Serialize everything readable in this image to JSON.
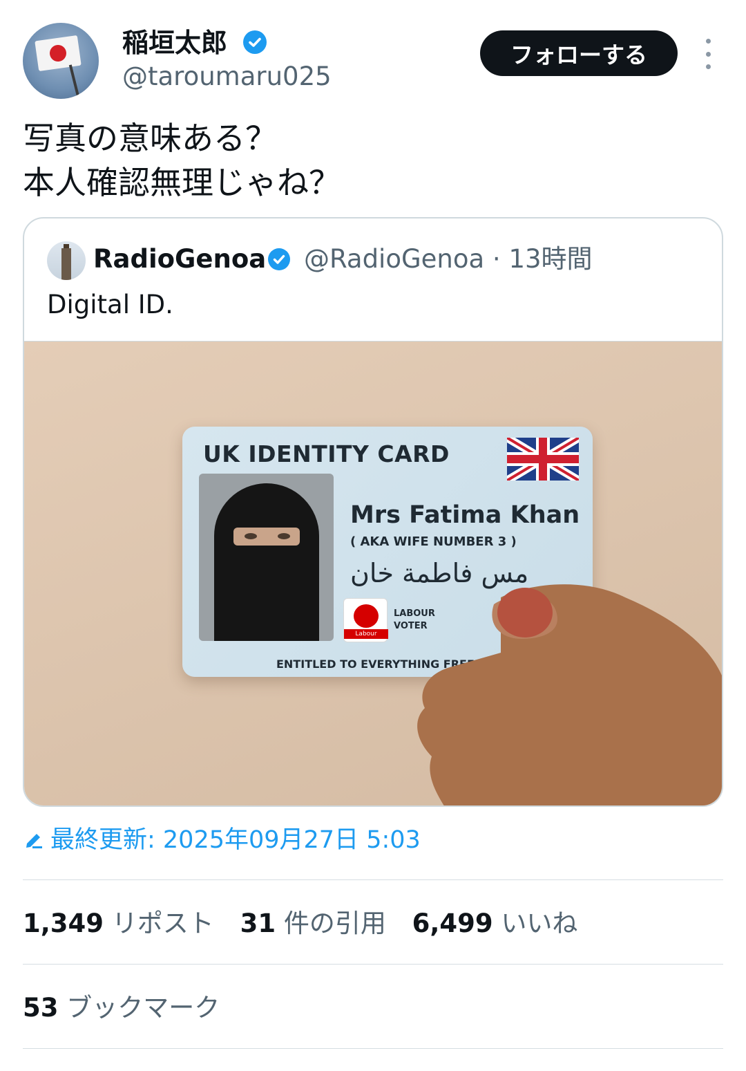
{
  "author": {
    "display_name": "稲垣太郎",
    "handle": "@taroumaru025",
    "avatar_icon": "japan-flag-avatar"
  },
  "follow_button": "フォローする",
  "tweet_text": "写真の意味ある？\n本人確認無理じゃね？",
  "quoted": {
    "display_name": "RadioGenoa",
    "handle_time": "@RadioGenoa · 13時間",
    "text": "Digital ID.",
    "image": {
      "card_title": "UK IDENTITY CARD",
      "name": "Mrs Fatima Khan",
      "aka": "( AKA  WIFE NUMBER 3 )",
      "arabic_name": "مس فاطمة خان",
      "logo_text": "Labour",
      "party_line1": "LABOUR",
      "party_line2": "VOTER",
      "footer": "ENTITLED TO EVERYTHING FREE"
    }
  },
  "edited": "最終更新: 2025年09月27日 5:03",
  "stats": {
    "reposts_count": "1,349",
    "reposts_label": "リポスト",
    "quotes_count": "31",
    "quotes_label": "件の引用",
    "likes_count": "6,499",
    "likes_label": "いいね",
    "bookmarks_count": "53",
    "bookmarks_label": "ブックマーク"
  },
  "colors": {
    "accent": "#1d9bf0",
    "text": "#0f1419",
    "secondary": "#536471"
  }
}
